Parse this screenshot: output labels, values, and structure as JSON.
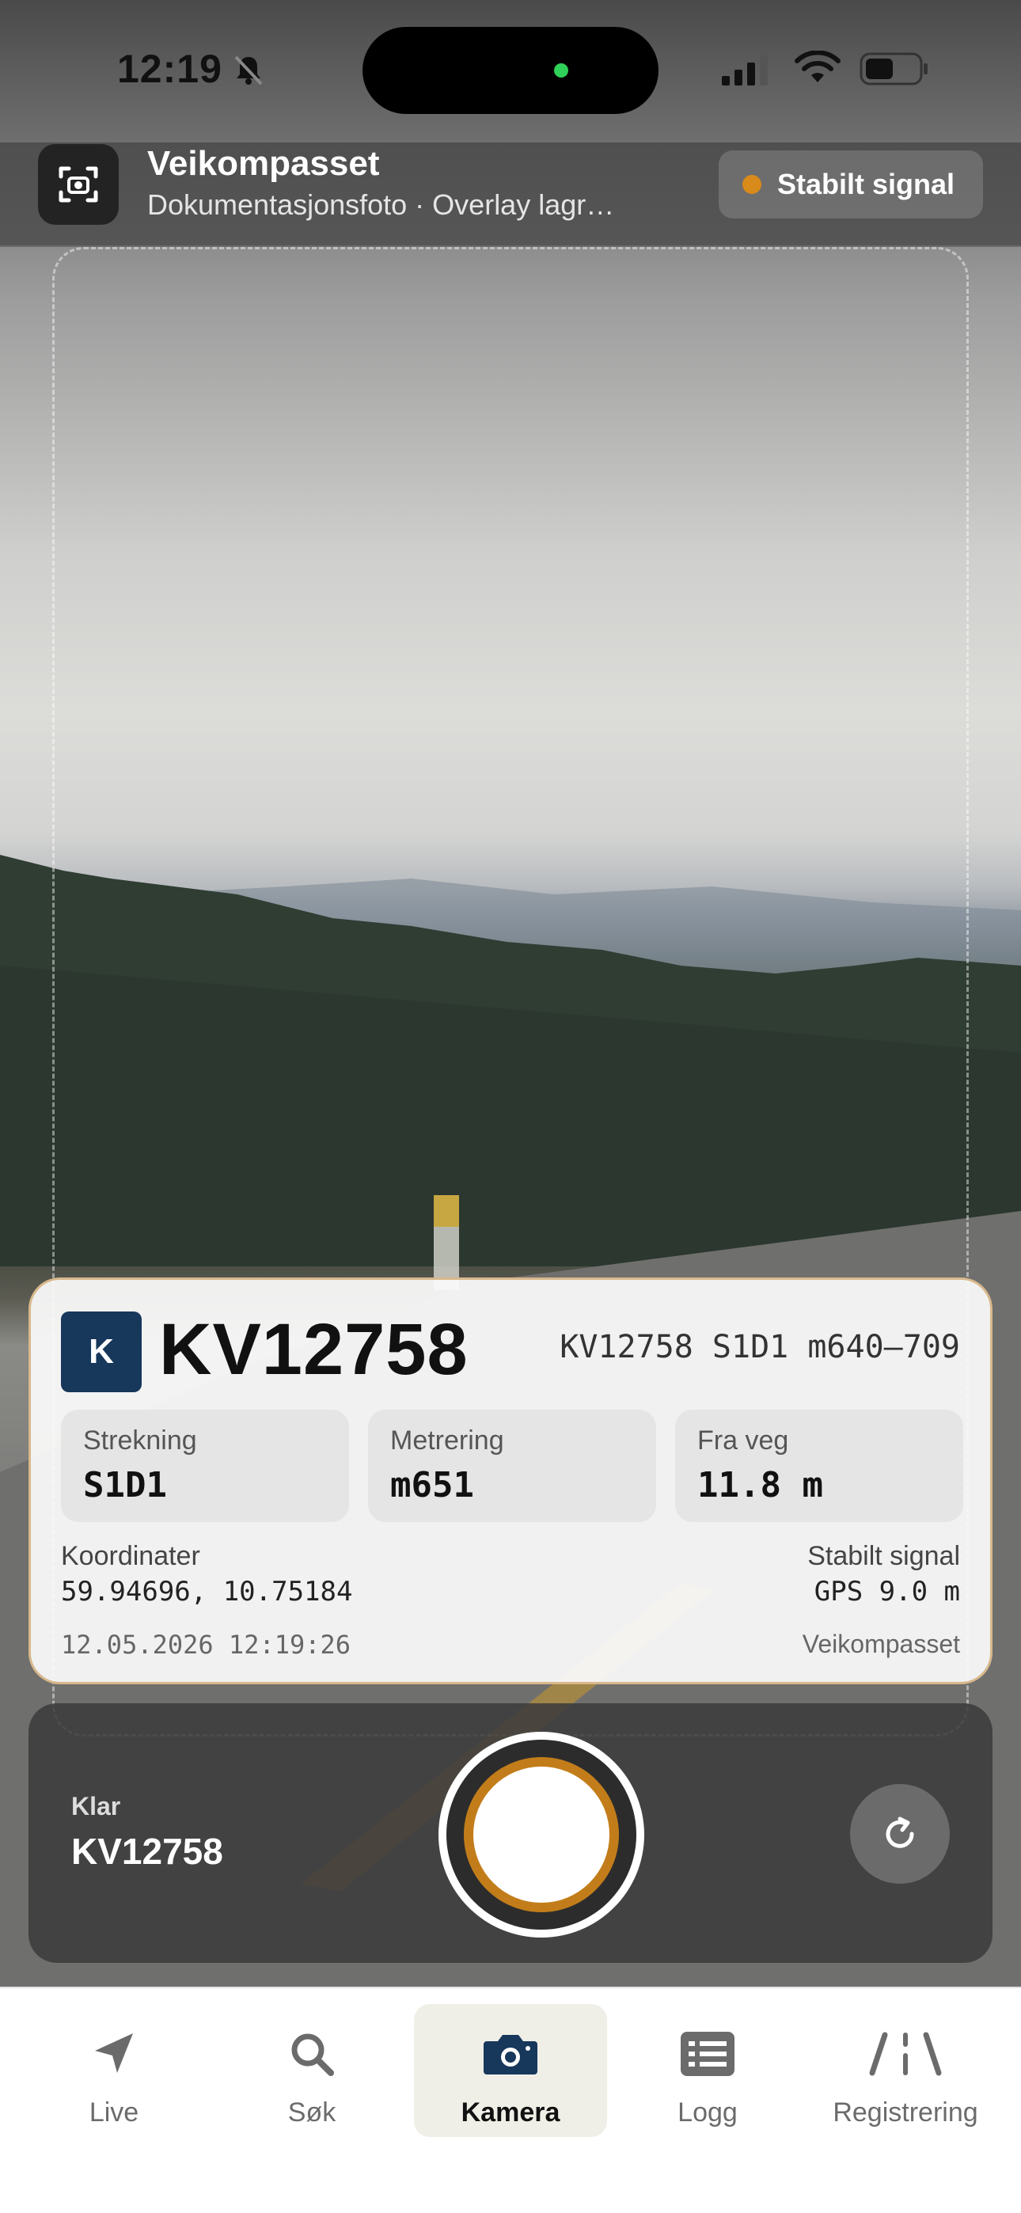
{
  "status_bar": {
    "time": "12:19",
    "icons": [
      "bell-slash-icon",
      "cellular-signal-icon",
      "wifi-icon",
      "battery-icon"
    ]
  },
  "header": {
    "icon": "camera-scan-icon",
    "title": "Veikompasset",
    "subtitle": "Dokumentasjonsfoto · Overlay lagr…",
    "signal_status": "Stabilt signal"
  },
  "overlay": {
    "badge": "K",
    "road_id": "KV12758",
    "reference": "KV12758 S1D1 m640–709",
    "tiles": [
      {
        "label": "Strekning",
        "value": "S1D1"
      },
      {
        "label": "Metrering",
        "value": "m651"
      },
      {
        "label": "Fra veg",
        "value": "11.8 m"
      }
    ],
    "coordinates_label": "Koordinater",
    "coordinates": "59.94696, 10.75184",
    "signal_label": "Stabilt signal",
    "gps": "GPS 9.0 m",
    "timestamp": "12.05.2026 12:19:26",
    "brand": "Veikompasset"
  },
  "capture": {
    "status_label": "Klar",
    "road_id": "KV12758",
    "shutter_icon": "shutter-icon",
    "refresh_icon": "refresh-icon"
  },
  "tabs": [
    {
      "label": "Live",
      "icon": "location-arrow-icon",
      "active": false
    },
    {
      "label": "Søk",
      "icon": "search-icon",
      "active": false
    },
    {
      "label": "Kamera",
      "icon": "camera-icon",
      "active": true
    },
    {
      "label": "Logg",
      "icon": "log-list-icon",
      "active": false
    },
    {
      "label": "Registrering",
      "icon": "road-icon",
      "active": false
    }
  ],
  "colors": {
    "accent_orange": "#c27d1a",
    "signal_dot": "#d88a1a",
    "badge_blue": "#17375b",
    "island_dot_green": "#30d158"
  }
}
